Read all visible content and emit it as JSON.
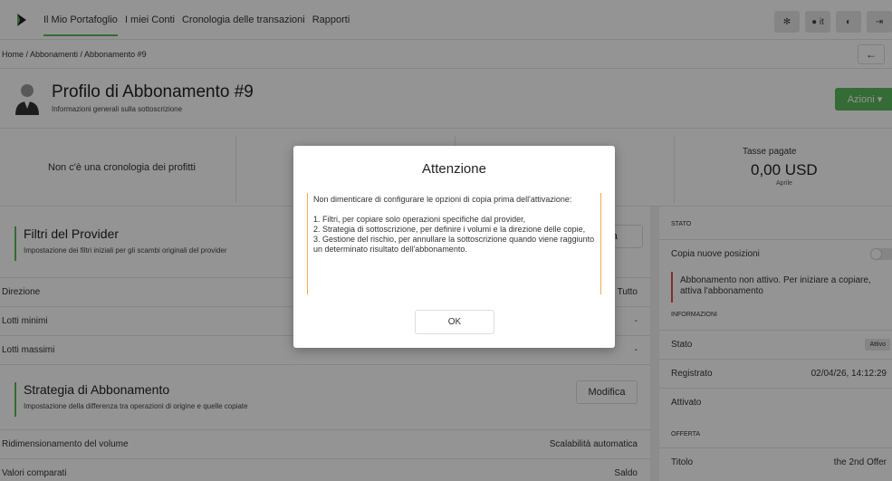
{
  "nav": {
    "items": [
      "Il Mio Portafoglio",
      "I miei Conti",
      "Cronologia delle transazioni",
      "Rapporti"
    ],
    "lang": "it"
  },
  "breadcrumb": "Home / Abbonamenti / Abbonamento #9",
  "back_label": "←",
  "header": {
    "title": "Profilo di Abbonamento #9",
    "subtitle": "Informazioni generali sulla sottoscrizione",
    "actions_label": "Azioni ▾"
  },
  "stats": {
    "no_profit": "Non c'è una cronologia dei profitti",
    "tax_label": "Tasse pagate",
    "tax_value": "0,00 USD",
    "tax_month": "Aprile"
  },
  "provider_filters": {
    "title": "Filtri del Provider",
    "subtitle": "Impostazione dei filtri iniziali per gli scambi originali del provider",
    "button": "ca",
    "rows": [
      {
        "label": "Direzione",
        "value": "Tutto"
      },
      {
        "label": "Lotti minimi",
        "value": "-"
      },
      {
        "label": "Lotti massimi",
        "value": "-"
      }
    ]
  },
  "strategy": {
    "title": "Strategia di Abbonamento",
    "subtitle": "Impostazione della differenza tra operazioni di origine e quelle copiate",
    "button": "Modifica",
    "rows": [
      {
        "label": "Ridimensionamento del volume",
        "value": "Scalabilità automatica"
      },
      {
        "label": "Valori comparati",
        "value": "Saldo"
      }
    ]
  },
  "sidebar": {
    "stato_head": "STATO",
    "copy_label": "Copia nuove posizioni",
    "warning": "Abbonamento non attivo. Per iniziare a copiare, attiva l'abbonamento",
    "info_head": "INFORMAZIONI",
    "stato_label": "Stato",
    "stato_badge": "Attivo",
    "registered_label": "Registrato",
    "registered_value": "02/04/26, 14:12:29",
    "activated_label": "Attivato",
    "offer_head": "OFFERTA",
    "title_label": "Titolo",
    "title_value": "the 2nd Offer"
  },
  "modal": {
    "title": "Attenzione",
    "intro": "Non dimenticare di configurare le opzioni di copia prima dell'attivazione:",
    "item1": "1. Filtri, per copiare solo operazioni specifiche dal provider,",
    "item2": "2. Strategia di sottoscrizione, per definire i volumi e la direzione delle copie,",
    "item3": "3. Gestione del rischio, per annullare la sottoscrizione quando viene raggiunto un determinato risultato dell'abbonamento.",
    "ok": "OK"
  }
}
